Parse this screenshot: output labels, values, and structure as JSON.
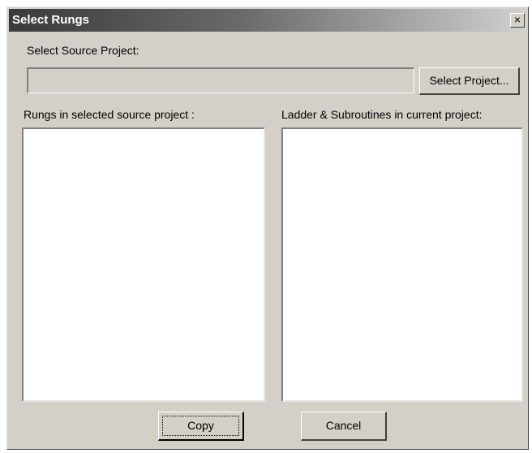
{
  "window": {
    "title": "Select Rungs",
    "close_glyph": "×"
  },
  "source": {
    "label": "Select Source Project:",
    "value": "",
    "button_label": "Select Project..."
  },
  "left_list": {
    "label": "Rungs in selected source project :",
    "items": []
  },
  "right_list": {
    "label": "Ladder & Subroutines in current project:",
    "items": []
  },
  "actions": {
    "copy_label": "Copy",
    "cancel_label": "Cancel"
  }
}
